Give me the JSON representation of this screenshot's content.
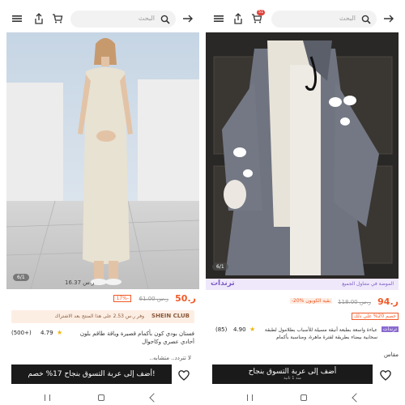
{
  "left": {
    "search_placeholder": "البحث",
    "image_counter": "6/1",
    "image_price_chip": "ر.س 16.37",
    "price": "50.ر",
    "original_price": "ر.س 61.00",
    "discount": "17%-",
    "club_banner": {
      "brand": "SHEIN CLUB",
      "text": "وفر ر.س 2.53 على هذا المنتج بعد الاشتراك"
    },
    "rating": "4.79",
    "rating_count": "(500+)",
    "title": "فستان بودي كون بأكمام قصيرة وياقة طاقم بلون أحادي عصري وكاجوال",
    "extra": "لا تتردد.. متشابه..",
    "buy_button": "أضف إلى عربة التسوق بنجاح 17% خصم!",
    "buy_icon": "cart-icon"
  },
  "right": {
    "search_placeholder": "البحث",
    "cart_badge": "51",
    "image_counter": "6/1",
    "trend_label": "ترندات",
    "trend_sub": "الموضة في متناول الجميع",
    "price": "94.ر",
    "original_price": "ر.س 118.00",
    "discount_tag": "بقية الكوبون %20-",
    "promo_tag": "خصم 20% على ذلك",
    "trending_tag": "ترندات",
    "rating": "4.90",
    "rating_count": "(85)",
    "title": "عباءة واسعة بطبعة أنيقة مسيلة للأسباب بطلامول لطبقة سحابية بيضاء بطريقة لفترة ماهرة، ومناسبة بأكمام",
    "size_label": "مقاس",
    "buy_button": "أضف إلى عربة التسوق بنجاح",
    "buy_sub": "منذ 1 ثانية"
  },
  "colors": {
    "accent": "#f05a28",
    "dark": "#1a1a1a",
    "club": "#fdeee4",
    "trend_bg": "#efe8fb",
    "trend_text": "#7c5cc4",
    "badge": "#e0413b"
  }
}
